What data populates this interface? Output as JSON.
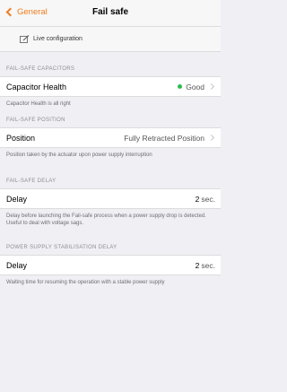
{
  "nav": {
    "back_label": "General",
    "title": "Fail safe"
  },
  "live_config": {
    "label": "Live configuration"
  },
  "sections": {
    "capacitors": {
      "header": "FAIL-SAFE CAPACITORS",
      "row_label": "Capacitor Health",
      "row_value": "Good",
      "status_color": "#2dbc4e",
      "footer": "Capacitor Health is all right"
    },
    "position": {
      "header": "FAIL-SAFE POSITION",
      "row_label": "Position",
      "row_value": "Fully Retracted Position",
      "footer": "Position taken by the actuator upon power supply interruption"
    },
    "delay": {
      "header": "FAIL-SAFE DELAY",
      "row_label": "Delay",
      "row_value": "2",
      "row_unit": "sec.",
      "footer": "Delay before launching the Fail-safe process when a power supply drop is detected. Useful to deal with voltage sags."
    },
    "stabilisation": {
      "header": "POWER SUPPLY STABILISATION DELAY",
      "row_label": "Delay",
      "row_value": "2",
      "row_unit": "sec.",
      "footer": "Waiting time for resuming the operation with a stable power supply"
    }
  },
  "colors": {
    "accent": "#f07d1e",
    "status_good": "#2dbc4e",
    "background": "#efeff4"
  }
}
